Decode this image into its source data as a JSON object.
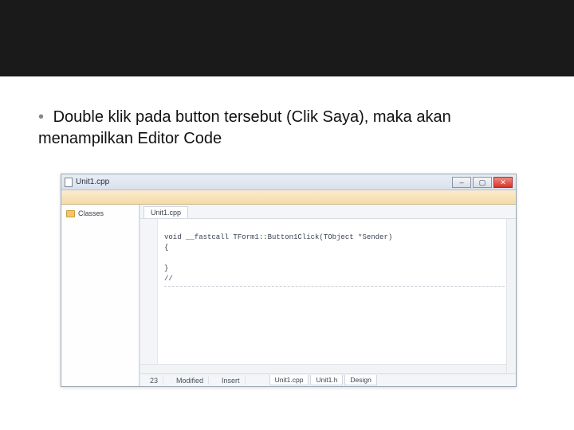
{
  "slide": {
    "bullet_text": "Double klik pada button tersebut (Clik Saya), maka akan menampilkan Editor Code"
  },
  "window": {
    "title": "Unit1.cpp",
    "min_label": "–",
    "max_label": "▢",
    "close_label": "✕"
  },
  "sidebar": {
    "tree_root": "Classes"
  },
  "editor": {
    "tab": "Unit1.cpp",
    "code": {
      "line1": "void __fastcall TForm1::Button1Click(TObject *Sender)",
      "line2": "{",
      "line3": "",
      "line4": "}",
      "line5": "//"
    }
  },
  "status": {
    "line_col": "23",
    "state": "Modified",
    "mode": "Insert"
  },
  "bottom_tabs": {
    "t1": "Unit1.cpp",
    "t2": "Unit1.h",
    "t3": "Design"
  }
}
